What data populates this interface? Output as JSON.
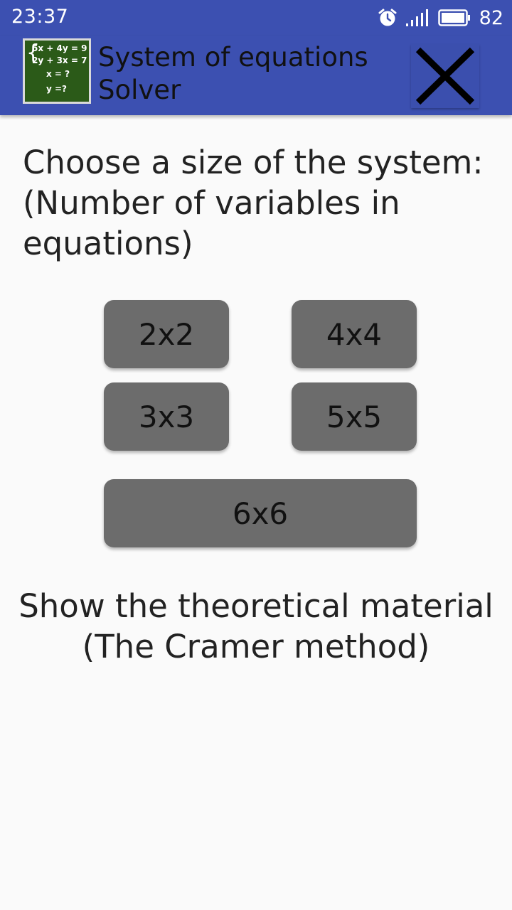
{
  "status_bar": {
    "time": "23:37",
    "battery_level": "82",
    "icons": [
      "alarm-icon",
      "signal-icon",
      "battery-icon"
    ]
  },
  "app_bar": {
    "title_line1": "System of equations",
    "title_line2": "Solver",
    "icon_lines": [
      "5x + 4y = 9",
      "2y + 3x = 7",
      "x = ?",
      "y =?"
    ],
    "close_icon": "close-icon"
  },
  "main": {
    "prompt_line1": "Choose a size of the system:",
    "prompt_line2": "(Number of variables in",
    "prompt_line3": "equations)",
    "sizes": {
      "s2": "2x2",
      "s3": "3x3",
      "s4": "4x4",
      "s5": "5x5",
      "s6": "6x6"
    },
    "theory_line1": "Show the theoretical material",
    "theory_line2": "(The Cramer method)"
  },
  "colors": {
    "primary": "#3c50b1",
    "button": "#6c6c6c",
    "background": "#fafafa",
    "icon_green": "#2b5a18"
  }
}
